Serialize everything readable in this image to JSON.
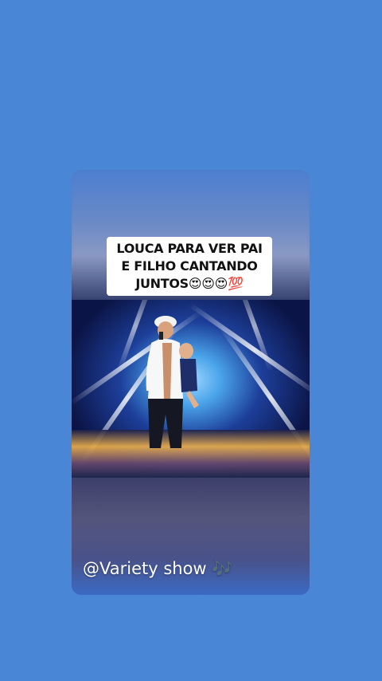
{
  "story": {
    "caption_lines": [
      "LOUCA PARA VER PAI",
      "E FILHO CANTANDO",
      "JUNTOS😍😍😍💯"
    ],
    "watermark": "@Variety show 🎶"
  },
  "colors": {
    "background": "#4a86d6",
    "caption_bg": "#ffffff",
    "caption_text": "#111111",
    "watermark_text": "#ffffff"
  }
}
